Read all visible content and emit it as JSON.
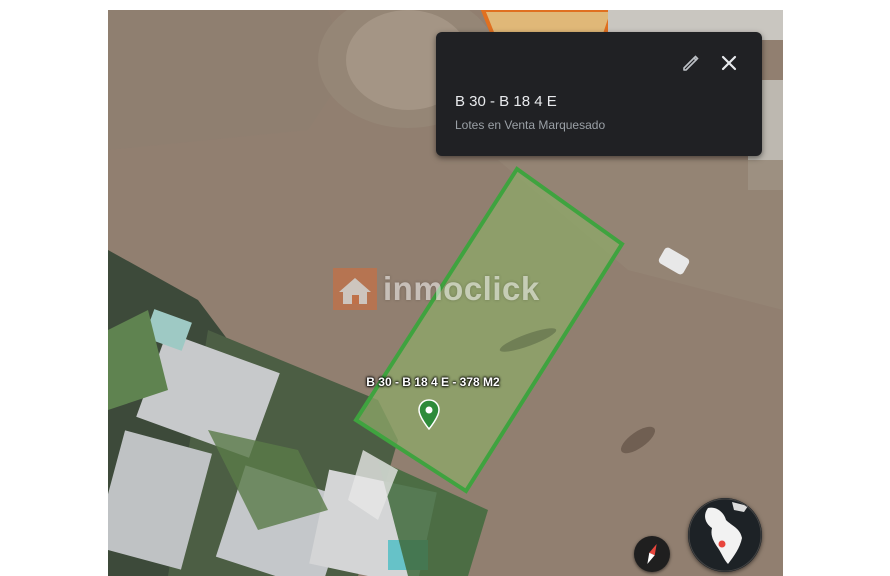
{
  "map": {
    "lot_label": "B 30 - B 18 4 E - 378 M2",
    "lot_outline_color": "#3fa33f",
    "pin_color": "#2e8b3a"
  },
  "watermark": {
    "text": "inmoclick",
    "logo_icon": "house-logo-icon"
  },
  "info_card": {
    "title": "B 30 - B 18 4 E",
    "subtitle": "Lotes en Venta Marquesado",
    "edit_icon": "pencil-icon",
    "close_icon": "close-icon"
  },
  "controls": {
    "compass_icon": "compass-icon",
    "globe_icon": "globe-icon"
  }
}
